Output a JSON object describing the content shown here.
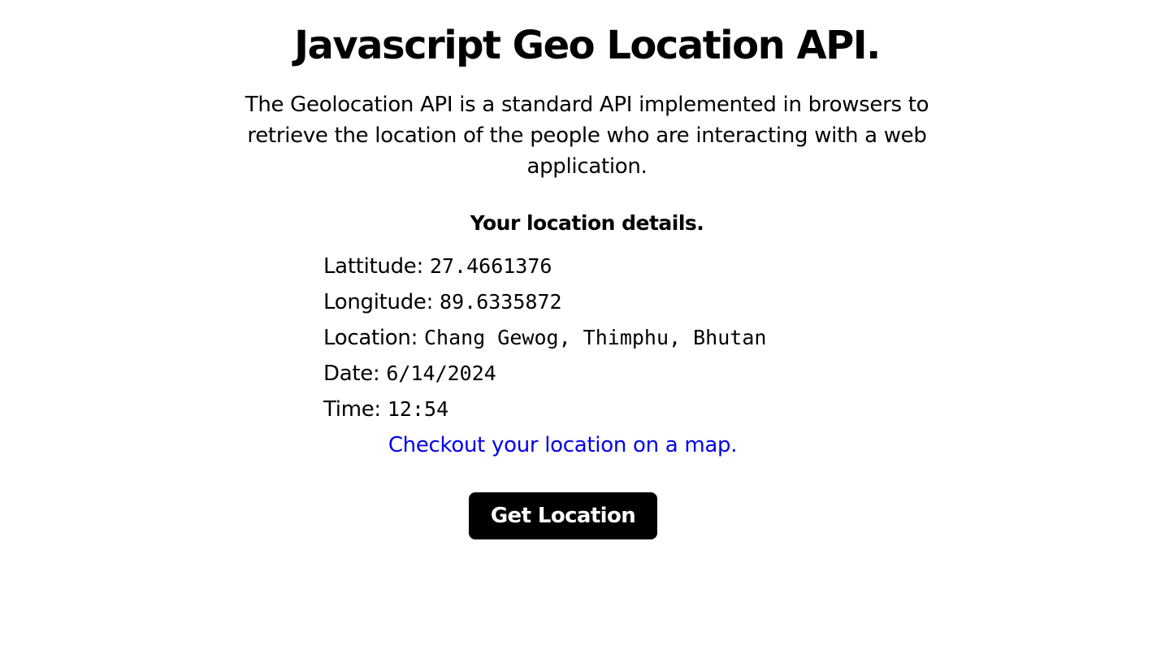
{
  "header": {
    "title": "Javascript Geo Location API.",
    "intro": "The Geolocation API is a standard API implemented in browsers to retrieve the location of the people who are interacting with a web application."
  },
  "details": {
    "heading": "Your location details.",
    "rows": [
      {
        "label": "Lattitude:",
        "value": "27.4661376"
      },
      {
        "label": "Longitude:",
        "value": "89.6335872"
      },
      {
        "label": "Location:",
        "value": "Chang Gewog, Thimphu, Bhutan"
      },
      {
        "label": "Date:",
        "value": "6/14/2024"
      },
      {
        "label": "Time:",
        "value": "12:54"
      }
    ],
    "map_link": "Checkout your location on a map."
  },
  "actions": {
    "get_location_label": "Get Location"
  },
  "colors": {
    "link": "#0000ee",
    "button_bg": "#000000",
    "button_text": "#ffffff"
  }
}
